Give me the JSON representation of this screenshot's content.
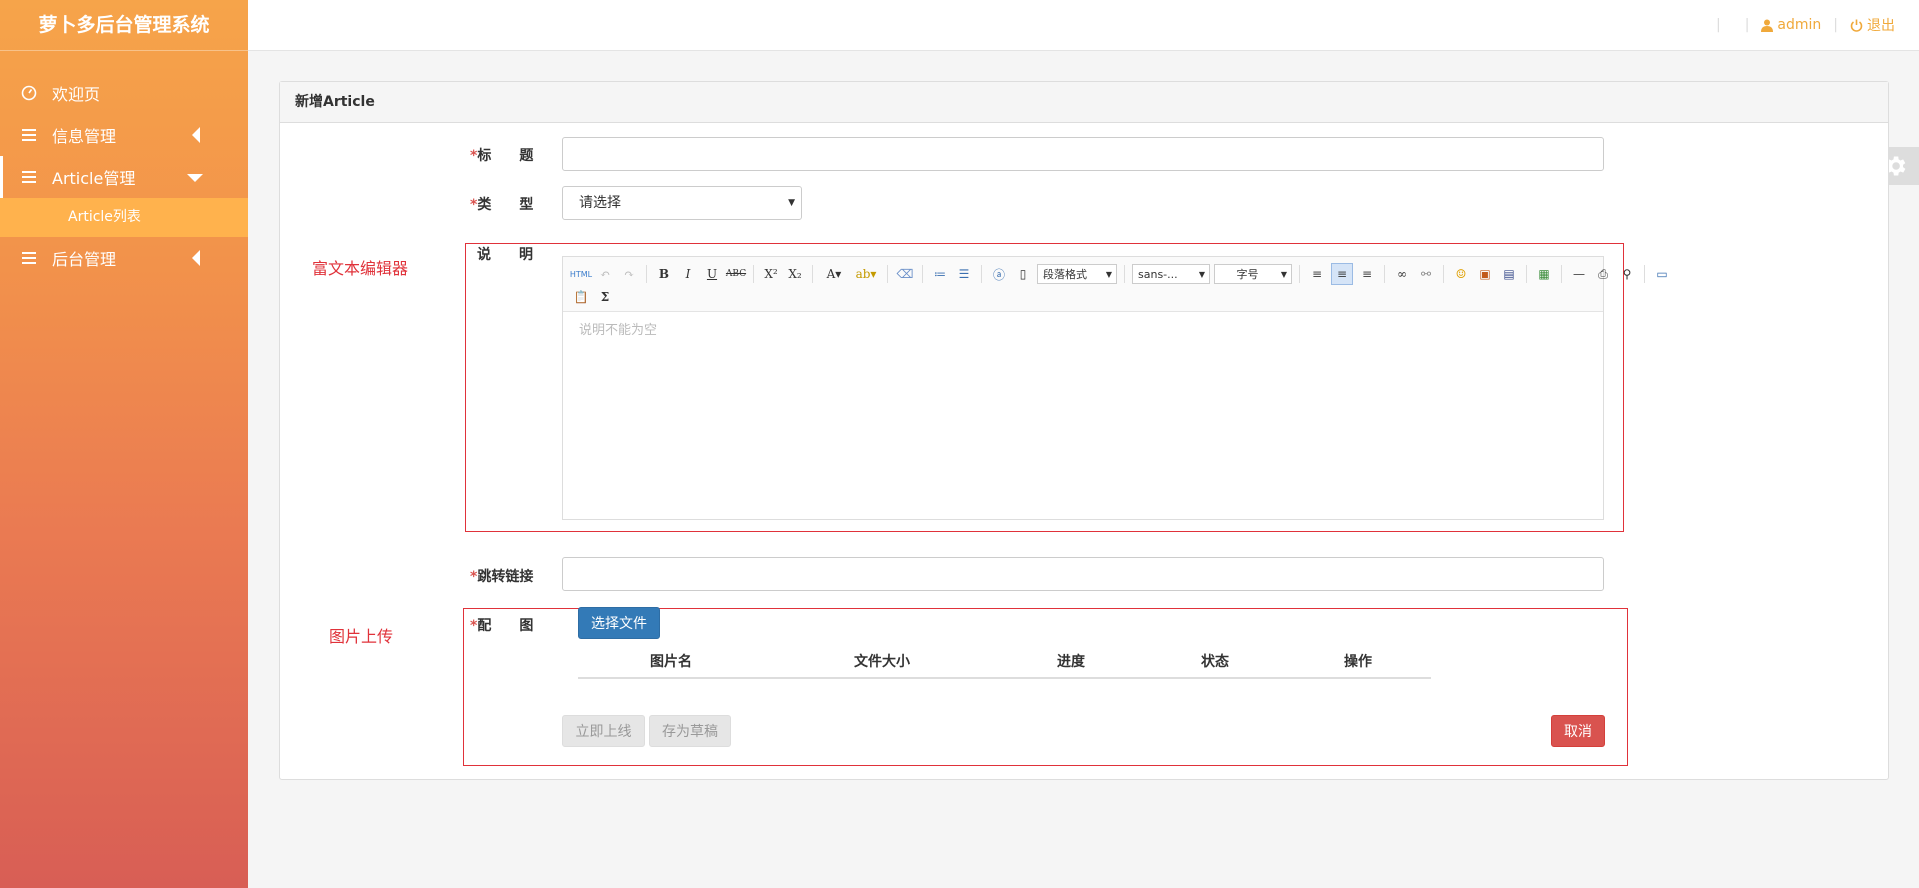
{
  "app": {
    "title": "萝卜多后台管理系统"
  },
  "sidebar": {
    "items": [
      {
        "label": "欢迎页",
        "icon": "dashboard-icon"
      },
      {
        "label": "信息管理",
        "icon": "menu-list-icon"
      },
      {
        "label": "Article管理",
        "icon": "menu-list-icon",
        "expanded": true,
        "children": [
          {
            "label": "Article列表"
          }
        ]
      },
      {
        "label": "后台管理",
        "icon": "menu-list-icon"
      }
    ]
  },
  "topbar": {
    "user": "admin",
    "logout": "退出"
  },
  "form": {
    "heading": "新增Article",
    "title_label": "标　　题",
    "type_label": "类　　型",
    "type_value": "请选择",
    "desc_label": "说　　明",
    "editor_placeholder": "说明不能为空",
    "link_label": "跳转链接",
    "image_label": "配　　图",
    "required_mark": "*",
    "choose_file": "选择文件",
    "upload_columns": [
      "图片名",
      "文件大小",
      "进度",
      "状态",
      "操作"
    ],
    "publish": "立即上线",
    "save_draft": "存为草稿",
    "cancel": "取消"
  },
  "editor_toolbar": {
    "paragraph": "段落格式",
    "font": "sans-...",
    "size": "字号"
  },
  "annotations": {
    "rich_editor": "富文本编辑器",
    "image_upload": "图片上传"
  },
  "colors": {
    "accent": "#f0a93b",
    "primary": "#337ab7",
    "danger": "#d9534f",
    "annotation": "#e0323a"
  }
}
